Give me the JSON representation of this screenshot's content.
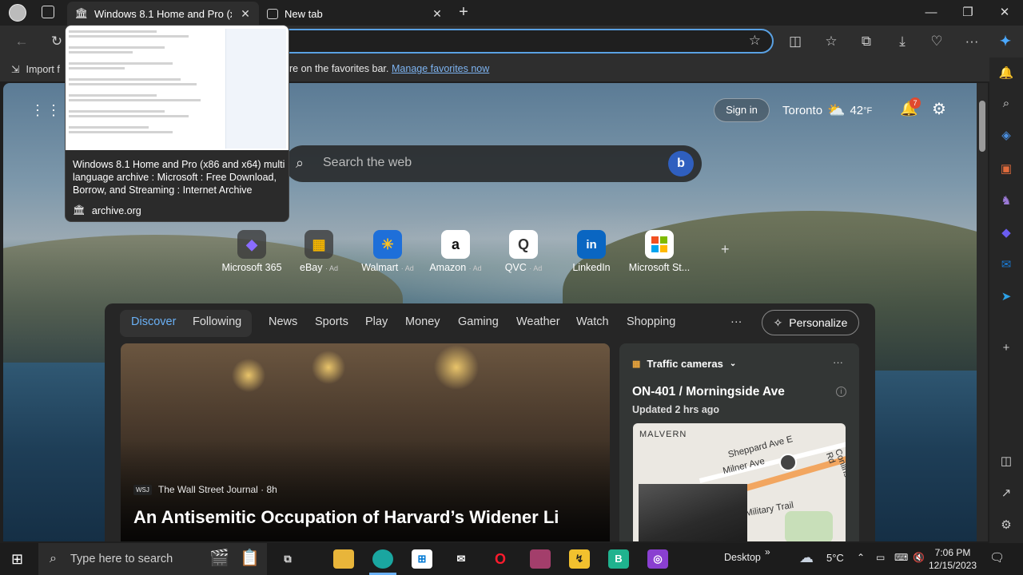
{
  "tabs": [
    {
      "title": "Windows 8.1 Home and Pro (x86",
      "icon": "archive-org-icon",
      "active": true
    },
    {
      "title": "New tab",
      "icon": "new-tab-icon",
      "active": false
    }
  ],
  "favorites_bar": {
    "import_label": "Import f",
    "hint": "re on the favorites bar.",
    "manage_link": "Manage favorites now"
  },
  "tab_preview": {
    "title": "Windows 8.1 Home and Pro (x86 and x64) multi language archive : Microsoft : Free Download, Borrow, and Streaming : Internet Archive",
    "domain": "archive.org"
  },
  "ntp": {
    "sign_in": "Sign in",
    "city": "Toronto",
    "temperature": "42",
    "temp_unit": "°F",
    "notification_count": "7",
    "search_placeholder": "Search the web",
    "quick_links": [
      {
        "label": "Microsoft 365",
        "ad": "",
        "glyph": "◆",
        "color": "#7a5cff"
      },
      {
        "label": "eBay",
        "ad": "· Ad",
        "glyph": "▦",
        "color": "#e0a100"
      },
      {
        "label": "Walmart",
        "ad": "· Ad",
        "glyph": "✳",
        "color": "#1e6fd9"
      },
      {
        "label": "Amazon",
        "ad": "· Ad",
        "glyph": "a",
        "color": "#222"
      },
      {
        "label": "QVC",
        "ad": "· Ad",
        "glyph": "Q",
        "color": "#eee"
      },
      {
        "label": "LinkedIn",
        "ad": "",
        "glyph": "in",
        "color": "#0a66c2"
      },
      {
        "label": "Microsoft St...",
        "ad": "",
        "glyph": "⊞",
        "color": "#f25022"
      }
    ],
    "add_link": "+"
  },
  "feed": {
    "tabs": [
      "Discover",
      "Following",
      "News",
      "Sports",
      "Play",
      "Money",
      "Gaming",
      "Weather",
      "Watch",
      "Shopping"
    ],
    "more": "···",
    "personalize": "Personalize",
    "hero": {
      "source": "The Wall Street Journal · 8h",
      "source_logo": "WSJ",
      "headline": "An Antisemitic Occupation of Harvard’s Widener Li"
    },
    "traffic": {
      "header": "Traffic cameras",
      "road": "ON-401 / Morningside Ave",
      "updated": "Updated 2 hrs ago",
      "map_labels": [
        "MALVERN",
        "Sheppard Ave E",
        "Milner Ave",
        "Military Trail",
        "Conlins Rd"
      ]
    }
  },
  "taskbar": {
    "search_placeholder": "Type here to search",
    "desktop_label": "Desktop",
    "weather": "5°C",
    "time": "7:06 PM",
    "date": "12/15/2023"
  }
}
